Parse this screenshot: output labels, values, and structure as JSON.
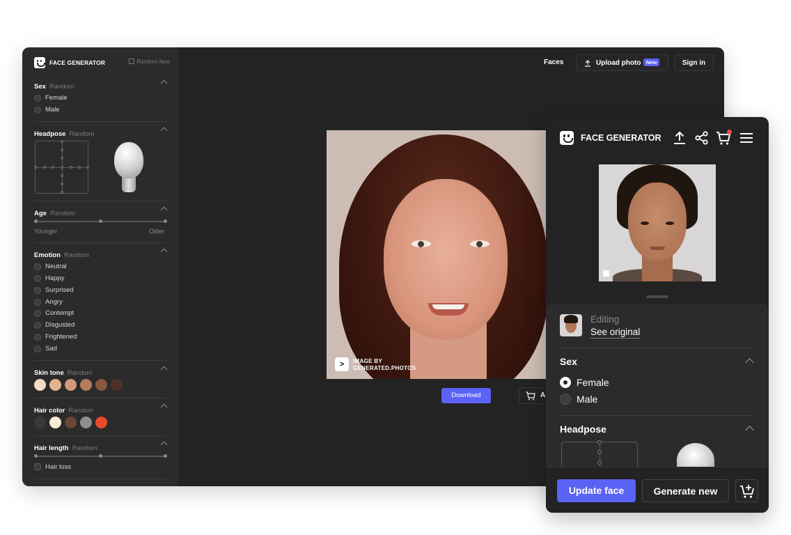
{
  "desktop": {
    "brand": "FACE GENERATOR",
    "random_face": "Random face",
    "nav": {
      "faces": "Faces",
      "upload": "Upload photo",
      "new_badge": "New",
      "signin": "Sign in"
    },
    "sections": {
      "sex": {
        "title": "Sex",
        "tag": "Random",
        "options": [
          "Female",
          "Male"
        ]
      },
      "headpose": {
        "title": "Headpose",
        "tag": "Random"
      },
      "age": {
        "title": "Age",
        "tag": "Random",
        "min_label": "Younger",
        "max_label": "Older"
      },
      "emotion": {
        "title": "Emotion",
        "tag": "Random",
        "options": [
          "Neutral",
          "Happy",
          "Surprised",
          "Angry",
          "Contempt",
          "Disgusted",
          "Frightened",
          "Sad"
        ]
      },
      "skin_tone": {
        "title": "Skin tone",
        "tag": "Random",
        "colors": [
          "#f3dcc0",
          "#e4b48d",
          "#d6987a",
          "#b57b5c",
          "#8a573f",
          "#4e3229"
        ]
      },
      "hair_color": {
        "title": "Hair color",
        "tag": "Random",
        "colors": [
          "#3a3a3a",
          "#f7ecd4",
          "#6b4634",
          "#8e8e8e",
          "#e94a2a"
        ]
      },
      "hair_length": {
        "title": "Hair length",
        "tag": "Random",
        "hair_loss": "Hair loss"
      }
    },
    "watermark": {
      "glyph": ">",
      "line1": "IMAGE BY",
      "line2": "GENERATED.PHOTOS"
    },
    "download": "Download",
    "add_to_cart": "A"
  },
  "mobile": {
    "brand": "FACE GENERATOR",
    "icons": [
      "upload-icon",
      "share-icon",
      "cart-icon",
      "menu-icon"
    ],
    "editing": "Editing",
    "see_original": "See original",
    "sex": {
      "title": "Sex",
      "options": [
        "Female",
        "Male"
      ],
      "selected": "Female"
    },
    "headpose": {
      "title": "Headpose"
    },
    "update_face": "Update face",
    "generate_new": "Generate new"
  }
}
